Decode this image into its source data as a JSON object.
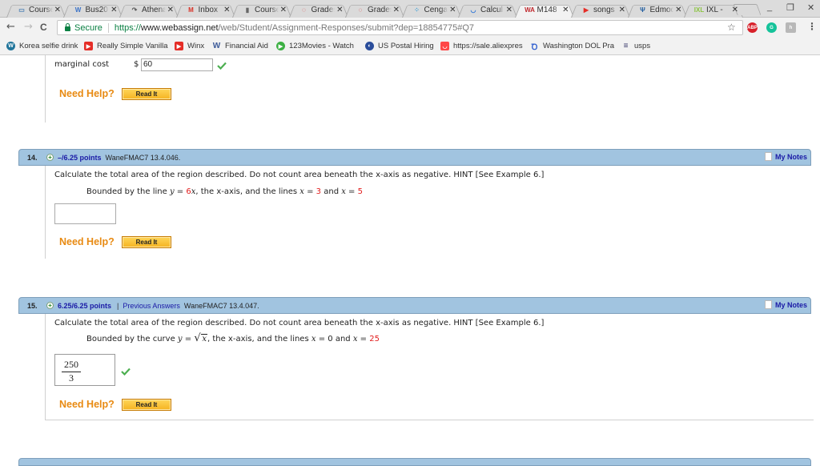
{
  "browser": {
    "tabs": [
      {
        "title": "Course",
        "icon": "coursera-icon",
        "color": "#4a7fb5",
        "active": false
      },
      {
        "title": "Bus20",
        "icon": "w-icon",
        "color": "#3b73c7",
        "active": false
      },
      {
        "title": "Athena",
        "icon": "athena-icon",
        "color": "#555555",
        "active": false
      },
      {
        "title": "Inbox",
        "icon": "gmail-icon",
        "color": "#d93025",
        "active": false
      },
      {
        "title": "Course",
        "icon": "document-icon",
        "color": "#666666",
        "active": false
      },
      {
        "title": "Grades",
        "icon": "grades-icon",
        "color": "#e02020",
        "active": false
      },
      {
        "title": "Grades",
        "icon": "grades-icon",
        "color": "#e02020",
        "active": false
      },
      {
        "title": "Cengage",
        "icon": "cengage-icon",
        "color": "#3aa0d8",
        "active": false
      },
      {
        "title": "Calcul",
        "icon": "loading-icon",
        "color": "#2a73d8",
        "active": false
      },
      {
        "title": "M148",
        "icon": "webassign-icon",
        "color": "#c0282d",
        "active": true
      },
      {
        "title": "songs",
        "icon": "youtube-icon",
        "color": "#e52d27",
        "active": false
      },
      {
        "title": "Edmodo",
        "icon": "edmodo-icon",
        "color": "#1e5b9e",
        "active": false
      },
      {
        "title": "IXL - ",
        "icon": "ixl-icon",
        "color": "#8bc43f",
        "active": false
      }
    ],
    "window_controls": {
      "minimize": "_",
      "restore": "❐",
      "close": "✕"
    },
    "nav": {
      "back": "←",
      "forward": "→",
      "reload": "C"
    },
    "address": {
      "secure_label": "Secure",
      "scheme": "https://",
      "host": "www.webassign.net",
      "path": "/web/Student/Assignment-Responses/submit?dep=18854775#Q7"
    },
    "extensions": [
      {
        "name": "adblock-plus-icon",
        "label": "ABP",
        "color": "#d8202a"
      },
      {
        "name": "grammarly-icon",
        "label": "G",
        "color": "#15c39a"
      },
      {
        "name": "extension-icon",
        "label": "h",
        "color": "#b8b8b8"
      }
    ],
    "bookmarks": [
      {
        "label": "Korea selfie drink",
        "icon": "wordpress-icon",
        "color": "#21759b",
        "glyph": "W"
      },
      {
        "label": "Really Simple Vanilla",
        "icon": "youtube-icon",
        "color": "#e52d27",
        "glyph": "▶"
      },
      {
        "label": "Winx",
        "icon": "youtube-icon",
        "color": "#e52d27",
        "glyph": "▶"
      },
      {
        "label": "Financial Aid",
        "icon": "w-icon",
        "color": "#3b5998",
        "glyph": "W"
      },
      {
        "label": "123Movies - Watch",
        "icon": "play-icon",
        "color": "#3cb043",
        "glyph": "▶"
      },
      {
        "label": "US Postal Hiring",
        "icon": "usps-icon",
        "color": "#2a4d9b",
        "glyph": "◐"
      },
      {
        "label": "https://sale.aliexpres",
        "icon": "aliexpress-icon",
        "color": "#ff4747",
        "glyph": "◡"
      },
      {
        "label": "Washington DOL Pra",
        "icon": "dol-icon",
        "color": "#2f5fcf",
        "glyph": "Ꝺ"
      },
      {
        "label": "usps",
        "icon": "usps-eagle-icon",
        "color": "#333366",
        "glyph": "≡"
      }
    ]
  },
  "page": {
    "q13_tail": {
      "label": "marginal cost",
      "currency": "$",
      "value": "60",
      "correct": true,
      "need_help": "Need Help?",
      "read_it": "Read It"
    },
    "questions": [
      {
        "number": "14.",
        "points": "–/6.25 points",
        "previous_answers": null,
        "code": "WaneFMAC7 13.4.046.",
        "my_notes": "My Notes",
        "prompt": "Calculate the total area of the region described. Do not count area beneath the x-axis as negative. HINT [See Example 6.]",
        "bounded": {
          "pre": "Bounded by the line",
          "func_lhs": "y",
          "func_coef": "6",
          "func_var": "x",
          "mid": ", the x-axis, and the lines",
          "a": "3",
          "b": "5"
        },
        "answer": "",
        "need_help": "Need Help?",
        "read_it": "Read It"
      },
      {
        "number": "15.",
        "points": "6.25/6.25 points",
        "previous_answers": "Previous Answers",
        "code": "WaneFMAC7 13.4.047.",
        "my_notes": "My Notes",
        "prompt": "Calculate the total area of the region described. Do not count area beneath the x-axis as negative. HINT [See Example 6.]",
        "bounded": {
          "pre": "Bounded by the curve",
          "func_lhs": "y",
          "func_var": "x",
          "mid": ", the x-axis, and the lines",
          "a": "0",
          "b": "25"
        },
        "answer": {
          "numerator": "250",
          "denominator": "3"
        },
        "correct": true,
        "need_help": "Need Help?",
        "read_it": "Read It"
      }
    ]
  },
  "colors": {
    "header_blue": "#a1c4e0",
    "link_blue": "#1a1aa6",
    "need_help_orange": "#e88a12",
    "highlight_red": "#e21d1d",
    "check_green": "#4caf50"
  }
}
